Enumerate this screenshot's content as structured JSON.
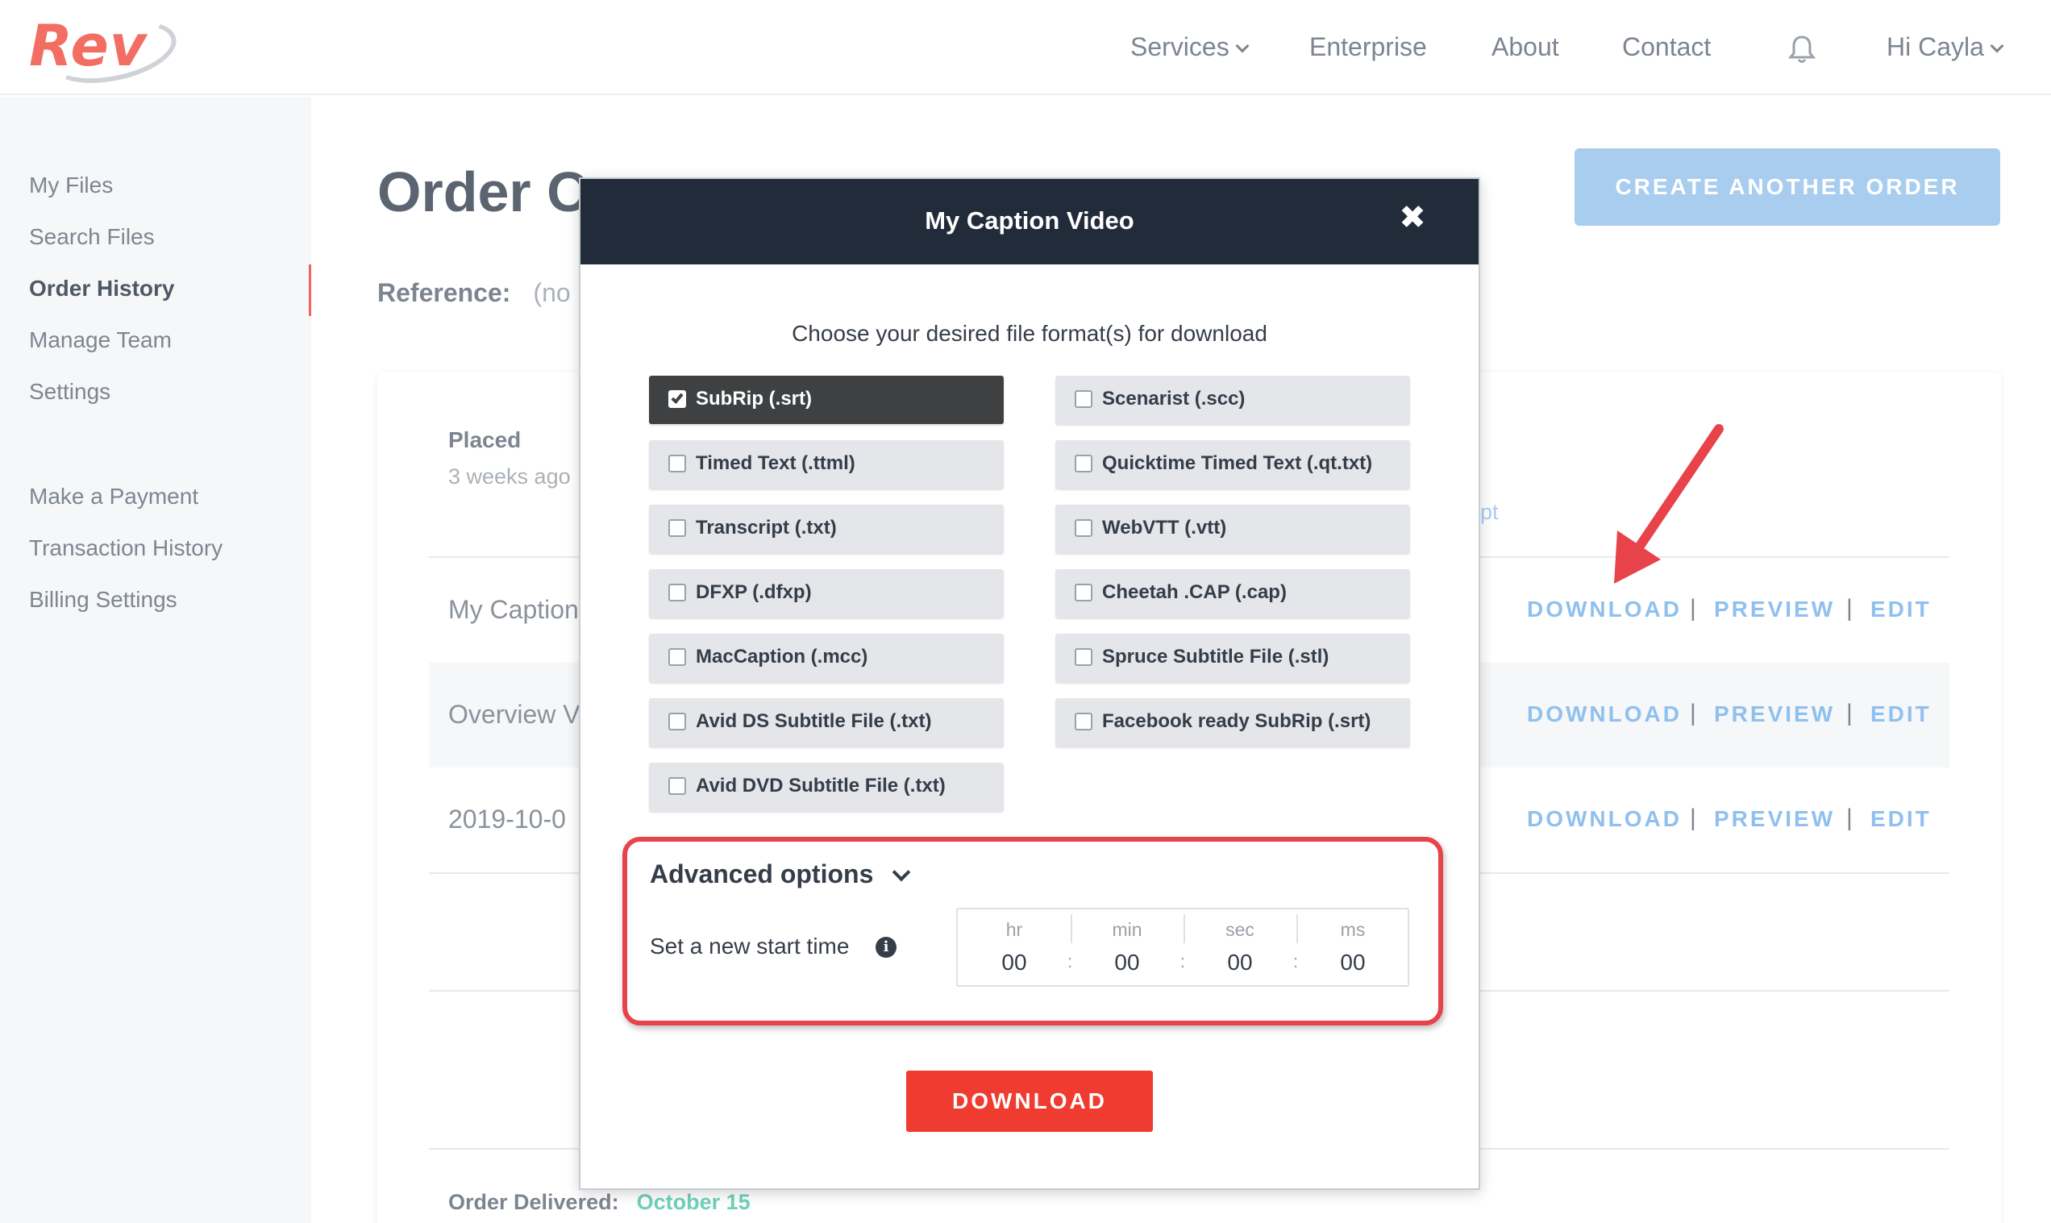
{
  "brand": {
    "logo_text": "Rev",
    "accent": "#f26e63"
  },
  "nav": {
    "services": "Services",
    "enterprise": "Enterprise",
    "about": "About",
    "contact": "Contact",
    "user": "Hi Cayla"
  },
  "sidebar": {
    "items": [
      {
        "label": "My Files"
      },
      {
        "label": "Search Files"
      },
      {
        "label": "Order History",
        "active": true
      },
      {
        "label": "Manage Team"
      },
      {
        "label": "Settings"
      },
      {
        "label": "Make a Payment"
      },
      {
        "label": "Transaction History"
      },
      {
        "label": "Billing Settings"
      }
    ]
  },
  "page": {
    "order_title": "Order O",
    "reference_label": "Reference:",
    "reference_value": "(no",
    "create_button": "CREATE ANOTHER ORDER",
    "placed_label": "Placed",
    "placed_value": "3 weeks ago",
    "fragment": "pt",
    "files": [
      {
        "name": "My Caption"
      },
      {
        "name": "Overview V"
      },
      {
        "name": "2019-10-0"
      }
    ],
    "actions": {
      "download": "DOWNLOAD",
      "preview": "PREVIEW",
      "edit": "EDIT",
      "separator": "|"
    },
    "delivered_label": "Order Delivered:",
    "delivered_value": "October 15"
  },
  "modal": {
    "title": "My Caption Video",
    "close_glyph": "✖",
    "subtitle": "Choose your desired file format(s) for download",
    "formats_left": [
      {
        "label": "SubRip (.srt)",
        "checked": true
      },
      {
        "label": "Timed Text (.ttml)",
        "checked": false
      },
      {
        "label": "Transcript (.txt)",
        "checked": false
      },
      {
        "label": "DFXP (.dfxp)",
        "checked": false
      },
      {
        "label": "MacCaption (.mcc)",
        "checked": false
      },
      {
        "label": "Avid DS Subtitle File (.txt)",
        "checked": false
      },
      {
        "label": "Avid DVD Subtitle File (.txt)",
        "checked": false
      }
    ],
    "formats_right": [
      {
        "label": "Scenarist (.scc)",
        "checked": false
      },
      {
        "label": "Quicktime Timed Text (.qt.txt)",
        "checked": false
      },
      {
        "label": "WebVTT (.vtt)",
        "checked": false
      },
      {
        "label": "Cheetah .CAP (.cap)",
        "checked": false
      },
      {
        "label": "Spruce Subtitle File (.stl)",
        "checked": false
      },
      {
        "label": "Facebook ready SubRip (.srt)",
        "checked": false
      }
    ],
    "advanced_title": "Advanced options",
    "start_time_label": "Set a new start time",
    "info_glyph": "i",
    "time": {
      "hr_label": "hr",
      "hr": "00",
      "min_label": "min",
      "min": "00",
      "sec_label": "sec",
      "sec": "00",
      "ms_label": "ms",
      "ms": "00"
    },
    "download_button": "DOWNLOAD"
  },
  "colors": {
    "modal_header": "#222b3a",
    "download_red": "#ef3b30",
    "link_blue": "#8fc0ee",
    "annotation_red": "#e8424a"
  }
}
